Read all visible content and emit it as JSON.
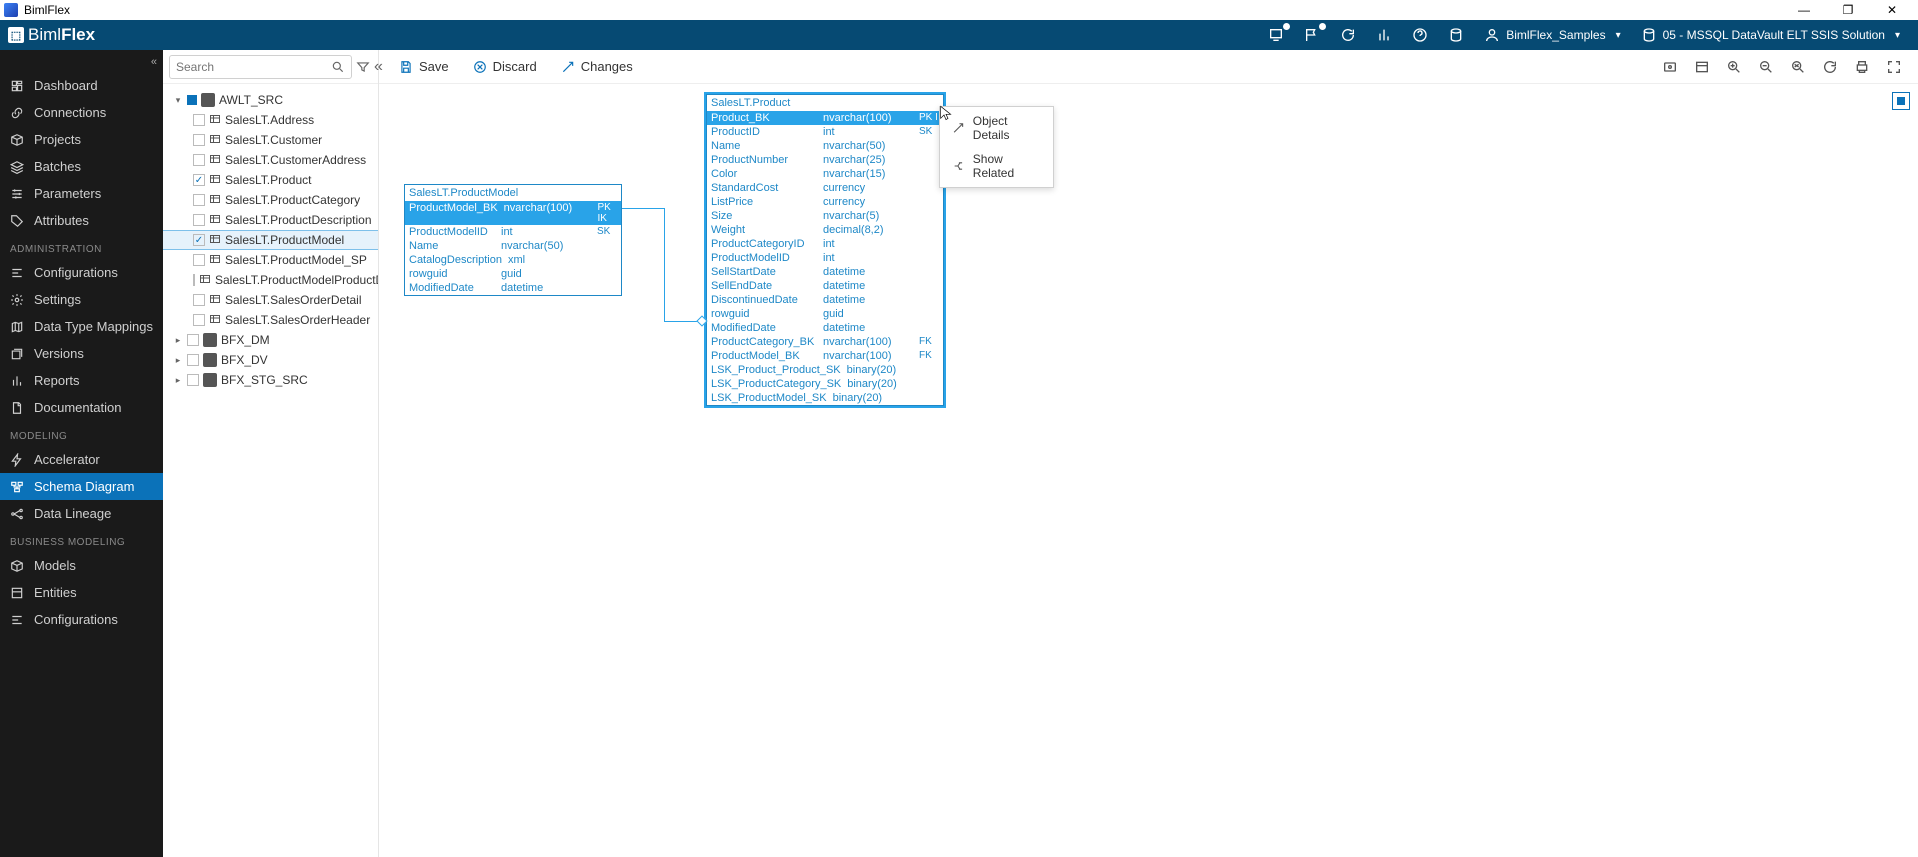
{
  "window": {
    "title": "BimlFlex",
    "minimize": "—",
    "maximize": "❐",
    "close": "✕"
  },
  "brand": {
    "text_before": "Biml",
    "text_after": "Flex"
  },
  "topbar": {
    "customer": "BimlFlex_Samples",
    "solution": "05 - MSSQL DataVault ELT SSIS Solution"
  },
  "sidebar": {
    "groups": [
      {
        "title": "",
        "items": [
          {
            "label": "Dashboard",
            "icon": "dashboard"
          },
          {
            "label": "Connections",
            "icon": "link"
          },
          {
            "label": "Projects",
            "icon": "box"
          },
          {
            "label": "Batches",
            "icon": "layers"
          },
          {
            "label": "Parameters",
            "icon": "sliders"
          },
          {
            "label": "Attributes",
            "icon": "tag"
          }
        ]
      },
      {
        "title": "ADMINISTRATION",
        "items": [
          {
            "label": "Configurations",
            "icon": "cfg"
          },
          {
            "label": "Settings",
            "icon": "gear"
          },
          {
            "label": "Data Type Mappings",
            "icon": "map"
          },
          {
            "label": "Versions",
            "icon": "versions"
          },
          {
            "label": "Reports",
            "icon": "report"
          },
          {
            "label": "Documentation",
            "icon": "doc"
          }
        ]
      },
      {
        "title": "MODELING",
        "items": [
          {
            "label": "Accelerator",
            "icon": "bolt"
          },
          {
            "label": "Schema Diagram",
            "icon": "schema",
            "active": true
          },
          {
            "label": "Data Lineage",
            "icon": "lineage"
          }
        ]
      },
      {
        "title": "BUSINESS MODELING",
        "items": [
          {
            "label": "Models",
            "icon": "cube"
          },
          {
            "label": "Entities",
            "icon": "entity"
          },
          {
            "label": "Configurations",
            "icon": "cfg"
          }
        ]
      }
    ]
  },
  "tree": {
    "search_placeholder": "Search",
    "sources": [
      {
        "label": "AWLT_SRC",
        "expanded": true,
        "tables": [
          {
            "label": "SalesLT.Address"
          },
          {
            "label": "SalesLT.Customer"
          },
          {
            "label": "SalesLT.CustomerAddress"
          },
          {
            "label": "SalesLT.Product",
            "checked": true
          },
          {
            "label": "SalesLT.ProductCategory"
          },
          {
            "label": "SalesLT.ProductDescription"
          },
          {
            "label": "SalesLT.ProductModel",
            "checked": true,
            "selected": true
          },
          {
            "label": "SalesLT.ProductModel_SP"
          },
          {
            "label": "SalesLT.ProductModelProductDes..."
          },
          {
            "label": "SalesLT.SalesOrderDetail"
          },
          {
            "label": "SalesLT.SalesOrderHeader"
          }
        ]
      },
      {
        "label": "BFX_DM"
      },
      {
        "label": "BFX_DV"
      },
      {
        "label": "BFX_STG_SRC"
      }
    ]
  },
  "actions": {
    "save": "Save",
    "discard": "Discard",
    "changes": "Changes"
  },
  "context_menu": {
    "item1": "Object Details",
    "item2": "Show Related"
  },
  "diagram": {
    "product_model": {
      "title": "SalesLT.ProductModel",
      "columns": [
        {
          "name": "ProductModel_BK",
          "type": "nvarchar(100)",
          "key": "PK IK",
          "header": true
        },
        {
          "name": "ProductModelID",
          "type": "int",
          "key": "SK"
        },
        {
          "name": "Name",
          "type": "nvarchar(50)",
          "key": ""
        },
        {
          "name": "CatalogDescription",
          "type": "xml",
          "key": ""
        },
        {
          "name": "rowguid",
          "type": "guid",
          "key": ""
        },
        {
          "name": "ModifiedDate",
          "type": "datetime",
          "key": ""
        }
      ]
    },
    "product": {
      "title": "SalesLT.Product",
      "columns": [
        {
          "name": "Product_BK",
          "type": "nvarchar(100)",
          "key": "PK I",
          "header": true
        },
        {
          "name": "ProductID",
          "type": "int",
          "key": "SK"
        },
        {
          "name": "Name",
          "type": "nvarchar(50)",
          "key": ""
        },
        {
          "name": "ProductNumber",
          "type": "nvarchar(25)",
          "key": ""
        },
        {
          "name": "Color",
          "type": "nvarchar(15)",
          "key": ""
        },
        {
          "name": "StandardCost",
          "type": "currency",
          "key": ""
        },
        {
          "name": "ListPrice",
          "type": "currency",
          "key": ""
        },
        {
          "name": "Size",
          "type": "nvarchar(5)",
          "key": ""
        },
        {
          "name": "Weight",
          "type": "decimal(8,2)",
          "key": ""
        },
        {
          "name": "ProductCategoryID",
          "type": "int",
          "key": ""
        },
        {
          "name": "ProductModelID",
          "type": "int",
          "key": ""
        },
        {
          "name": "SellStartDate",
          "type": "datetime",
          "key": ""
        },
        {
          "name": "SellEndDate",
          "type": "datetime",
          "key": ""
        },
        {
          "name": "DiscontinuedDate",
          "type": "datetime",
          "key": ""
        },
        {
          "name": "rowguid",
          "type": "guid",
          "key": ""
        },
        {
          "name": "ModifiedDate",
          "type": "datetime",
          "key": ""
        },
        {
          "name": "ProductCategory_BK",
          "type": "nvarchar(100)",
          "key": "FK"
        },
        {
          "name": "ProductModel_BK",
          "type": "nvarchar(100)",
          "key": "FK"
        },
        {
          "name": "LSK_Product_Product_SK",
          "type": "binary(20)",
          "key": ""
        },
        {
          "name": "LSK_ProductCategory_SK",
          "type": "binary(20)",
          "key": ""
        },
        {
          "name": "LSK_ProductModel_SK",
          "type": "binary(20)",
          "key": ""
        }
      ]
    }
  }
}
